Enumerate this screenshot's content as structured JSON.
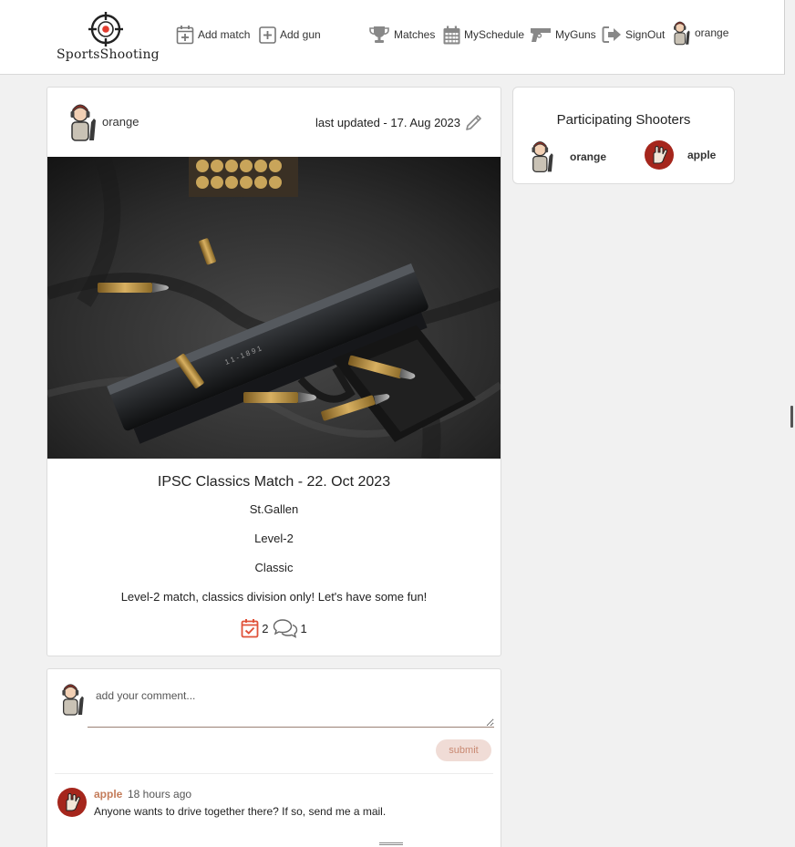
{
  "nav": {
    "logo_text": "SportsShooting",
    "add_match": "Add match",
    "add_gun": "Add gun",
    "matches": "Matches",
    "schedule": "MySchedule",
    "guns": "MyGuns",
    "signout": "SignOut",
    "user": "orange"
  },
  "post": {
    "author": "orange",
    "updated": "last updated - 17. Aug 2023",
    "title": "IPSC Classics Match - 22. Oct 2023",
    "location": "St.Gallen",
    "level": "Level-2",
    "division": "Classic",
    "description": "Level-2 match, classics division only! Let's have some fun!",
    "participants_count": "2",
    "comments_count": "1"
  },
  "comment_form": {
    "placeholder": "add your comment...",
    "submit_label": "submit"
  },
  "comments": [
    {
      "user": "apple",
      "time": "18 hours ago",
      "text": "Anyone wants to drive together there? If so, send me a mail."
    }
  ],
  "shooters": {
    "title": "Participating Shooters",
    "list": [
      "orange",
      "apple"
    ]
  },
  "colors": {
    "accent": "#e0523a",
    "comment_user": "#c47c5a",
    "submit_bg": "#f0dcd6"
  }
}
